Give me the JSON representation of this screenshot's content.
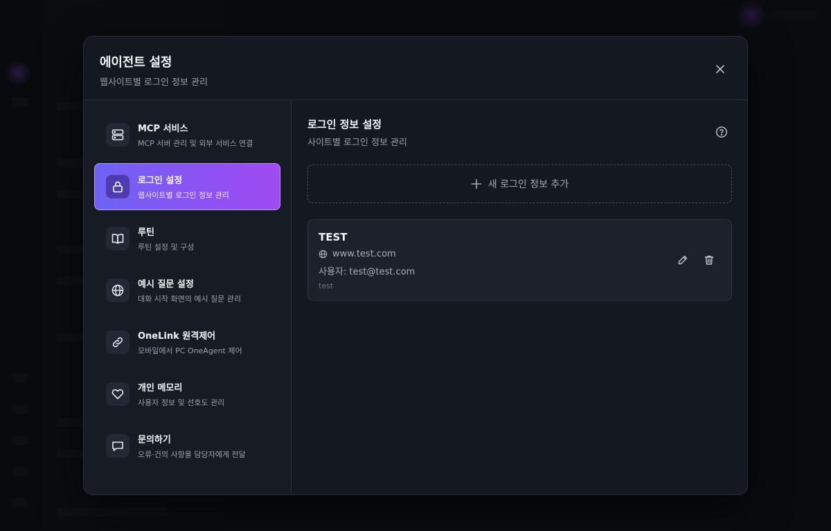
{
  "modal": {
    "title": "에이전트 설정",
    "subtitle": "웹사이트별 로그인 정보 관리"
  },
  "nav": {
    "items": [
      {
        "label": "MCP 서비스",
        "desc": "MCP 서버 관리 및 외부 서비스 연결",
        "icon": "server-icon"
      },
      {
        "label": "로그인 설정",
        "desc": "웹사이트별 로그인 정보 관리",
        "icon": "lock-icon",
        "active": true
      },
      {
        "label": "루틴",
        "desc": "루틴 설정 및 구성",
        "icon": "book-icon"
      },
      {
        "label": "예시 질문 설정",
        "desc": "대화 시작 화면의 예시 질문 관리",
        "icon": "globe-icon"
      },
      {
        "label": "OneLink 원격제어",
        "desc": "모바일에서 PC OneAgent 제어",
        "icon": "link-icon"
      },
      {
        "label": "개인 메모리",
        "desc": "사용자 정보 및 선호도 관리",
        "icon": "heart-icon"
      },
      {
        "label": "문의하기",
        "desc": "오류·건의 사항을 담당자에게 전달",
        "icon": "message-icon"
      }
    ]
  },
  "content": {
    "title": "로그인 정보 설정",
    "subtitle": "사이트별 로그인 정보 관리",
    "add_label": "새 로그인 정보 추가",
    "credentials": [
      {
        "name": "TEST",
        "url": "www.test.com",
        "user": "사용자: test@test.com",
        "note": "test"
      }
    ]
  },
  "colors": {
    "accent_start": "#6d63f5",
    "accent_end": "#a04bf2",
    "modal_bg": "#141821",
    "nav_bg": "#171b24"
  }
}
